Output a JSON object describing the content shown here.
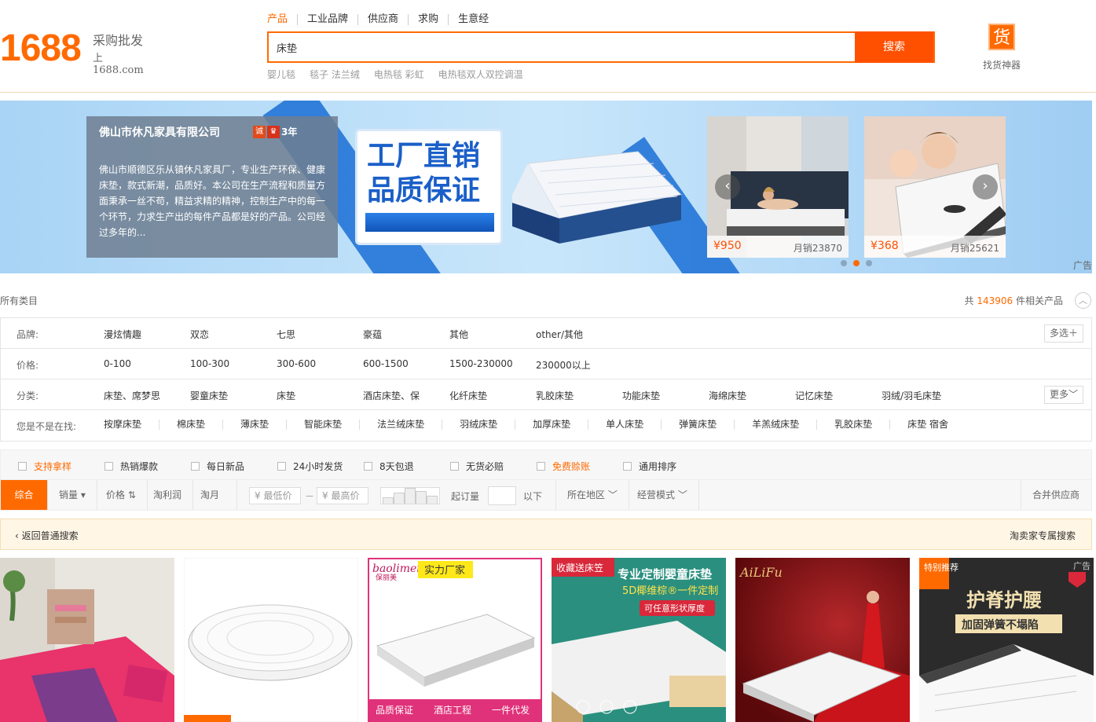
{
  "header": {
    "logo_number": "1688",
    "logo_slogan": "采购批发",
    "logo_domain": "上1688.com",
    "search_tabs": [
      "产品",
      "工业品牌",
      "供应商",
      "求购",
      "生意经"
    ],
    "search_value": "床垫",
    "search_button": "搜索",
    "hot_words": [
      "婴儿毯",
      "毯子 法兰绒",
      "电热毯 彩虹",
      "电热毯双人双控调温"
    ],
    "finder_icon_char": "货",
    "finder_label": "找货神器"
  },
  "banner": {
    "company_name": "佛山市休凡家具有限公司",
    "badge_cheng": "诚",
    "badge_crown": "♛",
    "years": "3年",
    "description": "佛山市顺德区乐从镇休凡家具厂，专业生产环保、健康床垫，款式新潮，品质好。本公司在生产流程和质量方面秉承一丝不苟，精益求精的精神，控制生产中的每一个环节，力求生产出的每件产品都是好的产品。公司经过多年的...",
    "promo_line1": "工厂直销",
    "promo_line2": "品质保证",
    "products": [
      {
        "price": "¥950",
        "sold": "月销23870"
      },
      {
        "price": "¥368",
        "sold": "月销25621"
      }
    ],
    "ad_label": "广告",
    "prev_arrow": "‹",
    "next_arrow": "›"
  },
  "results": {
    "all_categories": "所有类目",
    "total_prefix": "共",
    "total_count": "143906",
    "total_suffix": "件相关产品"
  },
  "filters": {
    "brand": {
      "label": "品牌:",
      "items": [
        "漫炫情趣",
        "双恋",
        "七思",
        "豪蕴",
        "其他",
        "other/其他"
      ],
      "button": "多选＋"
    },
    "price": {
      "label": "价格:",
      "items": [
        "0-100",
        "100-300",
        "300-600",
        "600-1500",
        "1500-230000",
        "230000以上"
      ]
    },
    "category": {
      "label": "分类:",
      "items": [
        "床垫、席梦思",
        "婴童床垫",
        "床垫",
        "酒店床垫、保",
        "化纤床垫",
        "乳胶床垫",
        "功能床垫",
        "海绵床垫",
        "记忆床垫",
        "羽绒/羽毛床垫"
      ],
      "button": "更多﹀"
    },
    "suggest": {
      "label": "您是不是在找:",
      "items": [
        "按摩床垫",
        "棉床垫",
        "薄床垫",
        "智能床垫",
        "法兰绒床垫",
        "羽绒床垫",
        "加厚床垫",
        "单人床垫",
        "弹簧床垫",
        "羊羔绒床垫",
        "乳胶床垫",
        "床垫 宿舍"
      ]
    }
  },
  "checkboxes": [
    "支持拿样",
    "热销爆款",
    "每日新品",
    "24小时发货",
    "8天包退",
    "无货必赔",
    "免费赊账",
    "通用排序"
  ],
  "sort": {
    "items": [
      "综合",
      "销量",
      "价格",
      "淘利润",
      "淘月销"
    ],
    "min_price_placeholder": "¥ 最低价",
    "max_price_placeholder": "¥ 最高价",
    "dash": "－",
    "moq_label": "起订量",
    "below_label": "以下",
    "region": "所在地区",
    "mode": "经营模式",
    "merge": "合并供应商"
  },
  "back_row": {
    "back": "返回普通搜索",
    "taobao": "淘卖家专属搜索"
  },
  "products": {
    "card3_brand": "baolimei",
    "card3_brand_cn": "保丽美",
    "card3_tag": "实力厂家",
    "card3_footer": [
      "品质保证",
      "酒店工程",
      "一件代发"
    ],
    "card4_top": "收藏送床笠",
    "card4_title": "专业定制婴童床垫",
    "card4_sub": "5D椰维棕®一件定制",
    "card4_tag": "可任意形状厚度",
    "card5_brand": "AiLiFu",
    "card6_badge": "特别推荐",
    "card6_title": "护脊护腰",
    "card6_sub": "加固弹簧不塌陷",
    "card6_ad": "广告"
  },
  "colors": {
    "brand": "#ff6a00",
    "search_button": "#ff5000"
  }
}
